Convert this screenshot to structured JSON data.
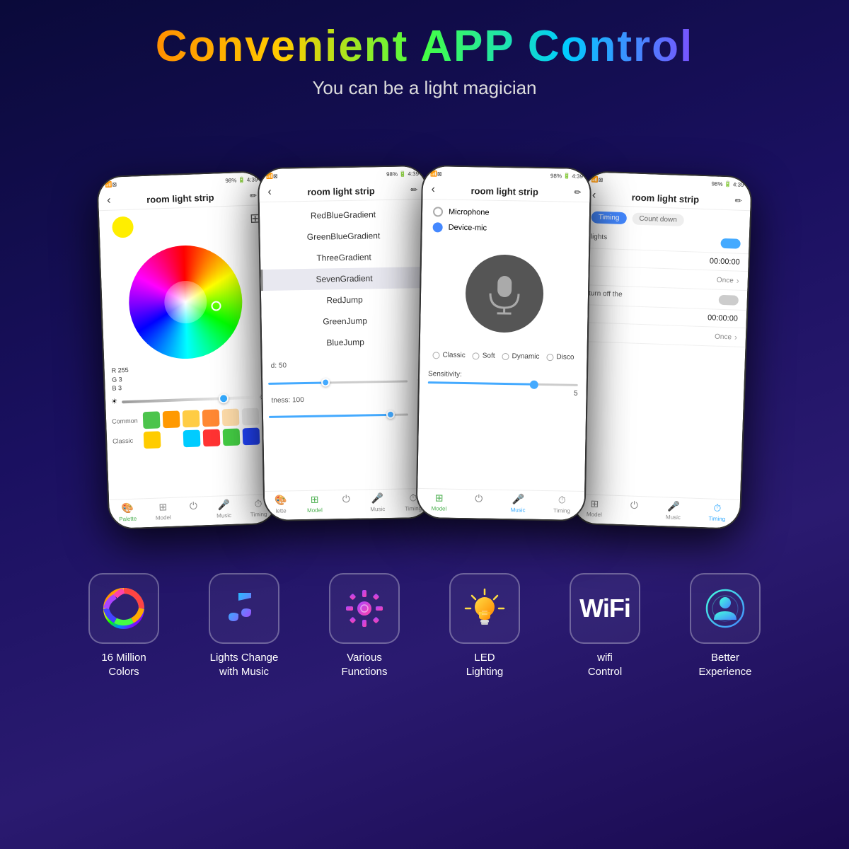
{
  "header": {
    "title": "Convenient APP Control",
    "subtitle": "You can be a light magician"
  },
  "phones": [
    {
      "id": "phone1",
      "title": "room light strip",
      "statusLeft": "..il.Σ⊠",
      "statusRight": "98% 4:39",
      "screen": "palette"
    },
    {
      "id": "phone2",
      "title": "room light strip",
      "statusLeft": "..il.Σ⊠",
      "statusRight": "98% 4:39",
      "screen": "modes"
    },
    {
      "id": "phone3",
      "title": "room light strip",
      "statusLeft": "..il.Σ⊠",
      "statusRight": "98% 4:39",
      "screen": "microphone"
    },
    {
      "id": "phone4",
      "title": "room light strip",
      "statusLeft": "..il.Σ⊠",
      "statusRight": "98% 4:39",
      "screen": "timing"
    }
  ],
  "modes": [
    "RedBlueGradient",
    "GreenBlueGradient",
    "ThreeGradient",
    "SevenGradient",
    "RedJump",
    "GreenJump",
    "BlueJump"
  ],
  "timing": {
    "tab1": "Timing",
    "tab2": "Count down",
    "lights_label": "lights",
    "time1": "00:00:00",
    "once1": "Once",
    "turn_off_label": "turn off the",
    "time2": "00:00:00",
    "once2": "Once"
  },
  "rgb": {
    "r": "R 255",
    "g": "G  3",
    "b": "B  3"
  },
  "nav": {
    "palette": "Palette",
    "model": "Model",
    "music": "Music",
    "timing": "Timing"
  },
  "sound_modes": {
    "classic": "Classic",
    "soft": "Soft",
    "dynamic": "Dynamic",
    "disco": "Disco"
  },
  "mic": {
    "option1": "Microphone",
    "option2": "Device-mic",
    "sensitivity_label": "Sensitivity:",
    "sensitivity_value": "5"
  },
  "features": [
    {
      "icon": "color-wheel",
      "label": "16 Million\nColors"
    },
    {
      "icon": "music-note",
      "label": "Lights Change\nwith Music"
    },
    {
      "icon": "gear",
      "label": "Various\nFunctions"
    },
    {
      "icon": "bulb",
      "label": "LED\nLighting"
    },
    {
      "icon": "wifi",
      "label": "wifi\nControl"
    },
    {
      "icon": "person",
      "label": "Better\nExperience"
    }
  ]
}
